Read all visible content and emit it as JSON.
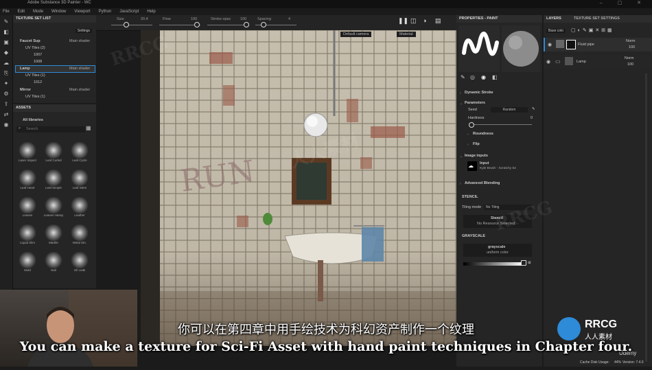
{
  "app": {
    "title": "Adobe Substance 3D Painter - WC"
  },
  "menu": [
    "File",
    "Edit",
    "Mode",
    "Window",
    "Viewport",
    "Python",
    "JavaScript",
    "Help"
  ],
  "toolbar": {
    "size_label": "Size",
    "size_value": "20.4",
    "flow_label": "Flow",
    "flow_value": "100",
    "stroke_label": "Stroke opac",
    "stroke_value": "100",
    "spacing_label": "Spacing",
    "spacing_value": "4"
  },
  "texture_set_list": {
    "title": "TEXTURE SET LIST",
    "settings_label": "Settings",
    "items": [
      {
        "name": "Faucet Sup",
        "shader": "Main shader",
        "uv": "UV Tiles (2)",
        "tiles": [
          "1007",
          "1008"
        ]
      },
      {
        "name": "Lamp",
        "shader": "Main shader",
        "uv": "UV Tiles (1)",
        "tiles": [
          "1012"
        ]
      },
      {
        "name": "Mirror",
        "shader": "Main shader",
        "uv": "UV Tiles (1)",
        "tiles": []
      }
    ]
  },
  "assets": {
    "title": "ASSETS",
    "library": "All libraries",
    "search_placeholder": "Search",
    "brushes": [
      "Laser Impact",
      "Leaf Curled",
      "Leaf Cycle",
      "Leaf Heart",
      "Leaf Simple",
      "Leaf Stem",
      "Leaves",
      "Leaves Heavy",
      "Leather",
      "Liquid Slim",
      "Marble",
      "Metal Stn.",
      "Mold",
      "Nail",
      "Oil Leak"
    ]
  },
  "viewport": {
    "camera": "Default camera",
    "mode": "Material",
    "graffiti": "RUN"
  },
  "properties": {
    "title": "PROPERTIES - PAINT",
    "dynamic_stroke": "Dynamic Stroke",
    "parameters": "Parameters",
    "seed_label": "Seed",
    "seed_value": "Random",
    "hardness_label": "Hardness",
    "hardness_value": "0",
    "roundness": "Roundness",
    "flip": "Flip",
    "image_inputs": "Image inputs",
    "input_name": "Input",
    "input_value": "Kyle Brush - Scratchy 54",
    "advanced_blending": "Advanced Blending",
    "stencil": "STENCIL",
    "tiling_label": "Tiling mode",
    "tiling_value": "No Tiling",
    "stencil_name": "Stencil",
    "stencil_value": "No Resource Selected",
    "grayscale": "GRAYSCALE",
    "grayscale_name": "grayscale",
    "grayscale_value": "uniform color"
  },
  "layers": {
    "tab1": "LAYERS",
    "tab2": "TEXTURE SET SETTINGS",
    "channel": "Base colo",
    "items": [
      {
        "name": "Fluid pipe",
        "blend": "Norm",
        "opacity": "100"
      },
      {
        "name": "Lamp",
        "blend": "Norm",
        "opacity": "100"
      }
    ]
  },
  "status": {
    "cache": "Cache Disk Usage:",
    "cache_value": "44%",
    "version": "Version: 7.4.0"
  },
  "subtitles": {
    "cn": "你可以在第四章中用手绘技术为科幻资产制作一个纹理",
    "en": "You can make a texture for Sci-Fi Asset with hand paint techniques in Chapter four."
  },
  "watermark": {
    "text": "RRCG",
    "cn": "人人素材",
    "brand": "Udemy"
  },
  "colors": {
    "accent": "#2d8bd8",
    "panel": "#252525",
    "header": "#2d2d2d"
  }
}
